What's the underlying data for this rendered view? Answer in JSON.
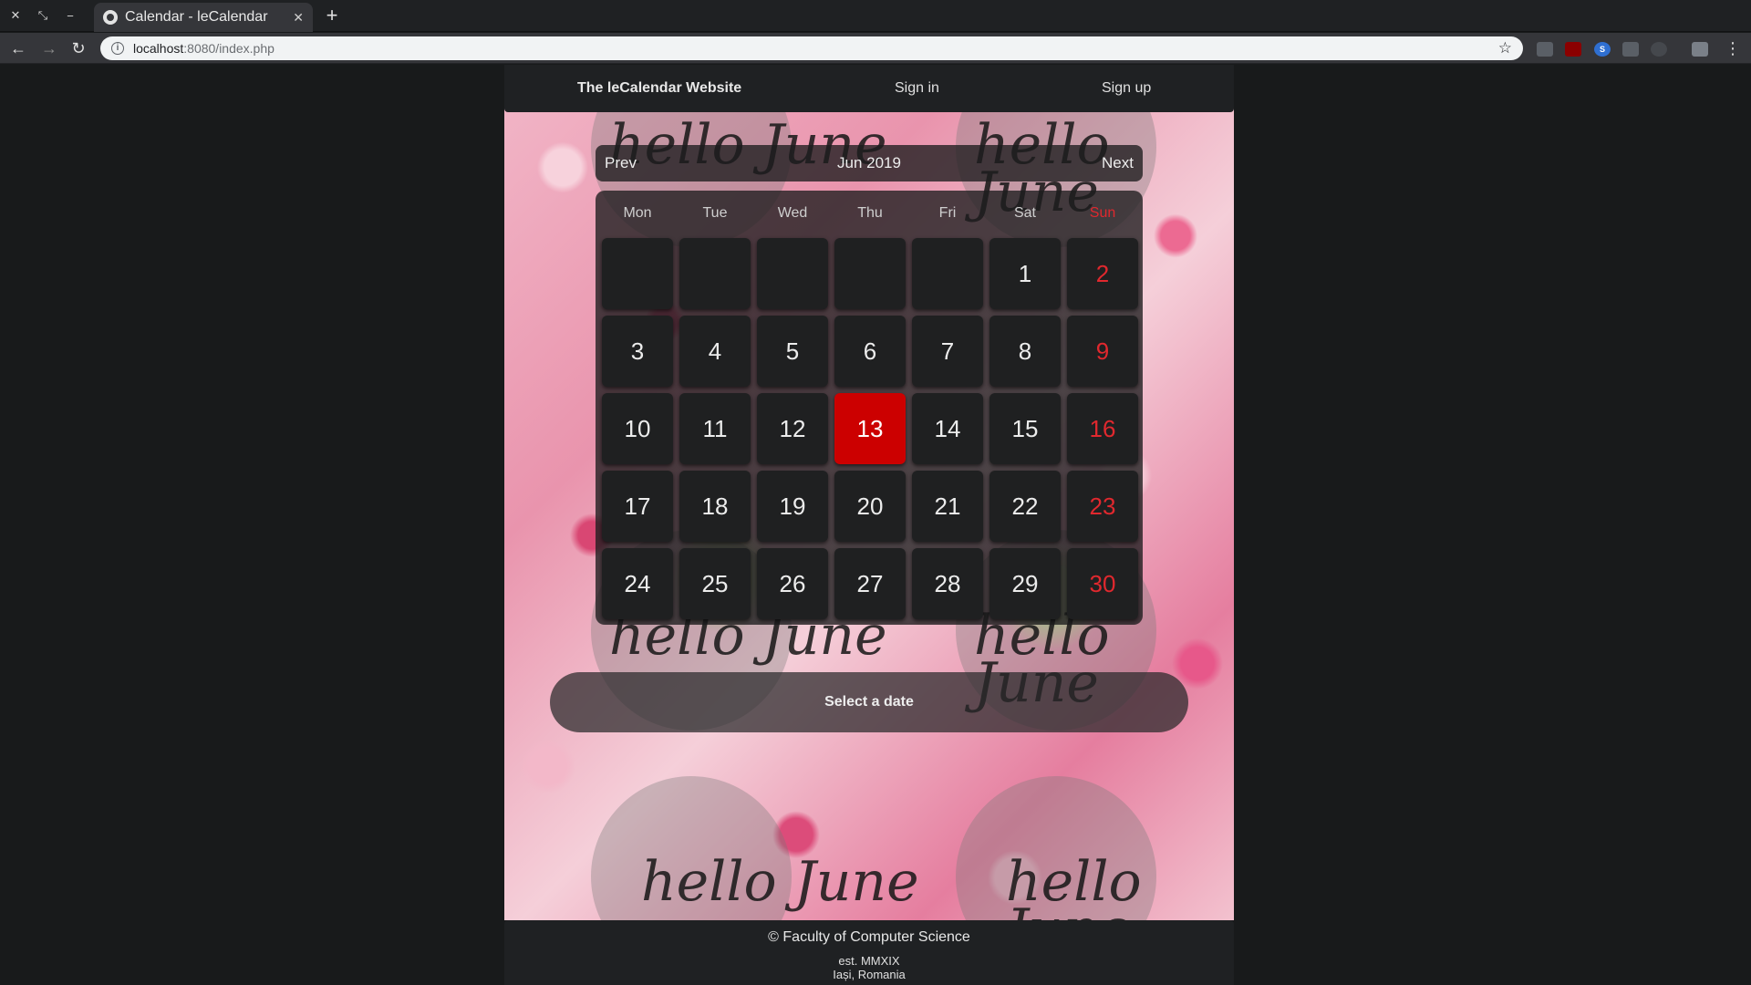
{
  "browser": {
    "tab_title": "Calendar - leCalendar",
    "url_host": "localhost",
    "url_path": ":8080/index.php"
  },
  "header": {
    "brand": "The leCalendar Website",
    "sign_in": "Sign in",
    "sign_up": "Sign up"
  },
  "background": {
    "text": "hello June"
  },
  "calendar": {
    "prev": "Prev",
    "next": "Next",
    "month_label": "Jun 2019",
    "weekdays": [
      "Mon",
      "Tue",
      "Wed",
      "Thu",
      "Fri",
      "Sat",
      "Sun"
    ],
    "weeks": [
      [
        "",
        "",
        "",
        "",
        "",
        "1",
        "2"
      ],
      [
        "3",
        "4",
        "5",
        "6",
        "7",
        "8",
        "9"
      ],
      [
        "10",
        "11",
        "12",
        "13",
        "14",
        "15",
        "16"
      ],
      [
        "17",
        "18",
        "19",
        "20",
        "21",
        "22",
        "23"
      ],
      [
        "24",
        "25",
        "26",
        "27",
        "28",
        "29",
        "30"
      ]
    ],
    "today": "13",
    "today_color": "#cc0000",
    "sunday_color": "#e0282e"
  },
  "status": {
    "select_prompt": "Select a date"
  },
  "footer": {
    "copyright": "© Faculty of Computer Science",
    "established": "est. MMXIX",
    "location": "Iași, Romania"
  }
}
